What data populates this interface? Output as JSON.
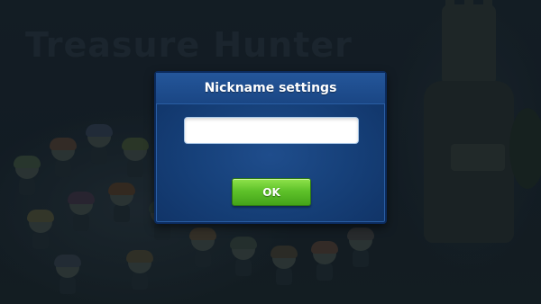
{
  "background": {
    "game_title": "Treasure Hunter"
  },
  "dialog": {
    "title": "Nickname settings",
    "nickname_input": {
      "value": "",
      "placeholder": ""
    },
    "ok_label": "OK"
  },
  "colors": {
    "dialog_bg": "#164079",
    "ok_button": "#5fc22a",
    "overlay": "#141d24"
  }
}
